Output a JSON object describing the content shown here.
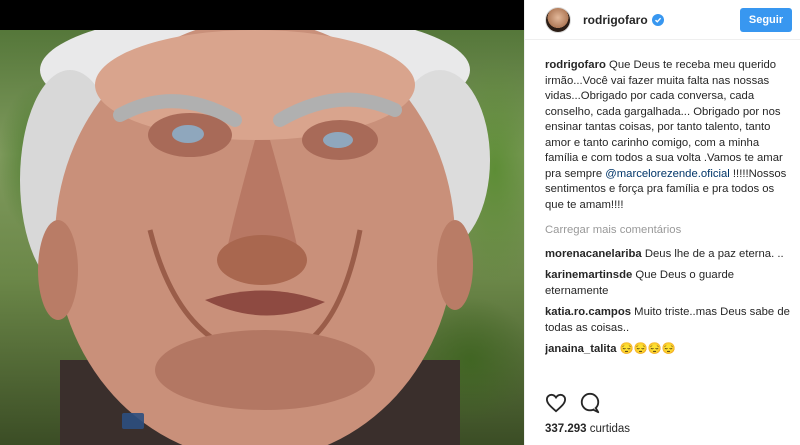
{
  "post": {
    "username": "rodrigofaro",
    "follow_label": "Seguir",
    "caption_user": "rodrigofaro",
    "caption_text_1": "Que Deus te receba meu querido irmão...Você vai fazer muita falta nas nossas vidas...Obrigado por cada conversa, cada conselho, cada gargalhada... Obrigado por nos ensinar tantas coisas, por tanto talento, tanto amor e tanto carinho comigo, com a minha família e com todos a sua volta .Vamos te amar pra sempre",
    "caption_mention": "@marcelorezende.oficial",
    "caption_text_2": "!!!!!Nossos sentimentos e força pra família e pra todos os que te amam!!!!",
    "load_more": "Carregar mais comentários",
    "comments": [
      {
        "user": "morenacanelariba",
        "text": "Deus lhe de a paz eterna. .."
      },
      {
        "user": "karinemartinsde",
        "text": "Que Deus o guarde eternamente"
      },
      {
        "user": "katia.ro.campos",
        "text": "Muito triste..mas Deus sabe de todas as coisas.."
      },
      {
        "user": "janaina_talita",
        "text": "😔😔😔😔"
      }
    ],
    "likes_count": "337.293",
    "likes_label": "curtidas"
  },
  "colors": {
    "accent": "#3897f0",
    "mention": "#003569",
    "muted": "#999999",
    "text": "#262626"
  },
  "icons": [
    "verified-icon",
    "heart-icon",
    "comment-icon"
  ]
}
